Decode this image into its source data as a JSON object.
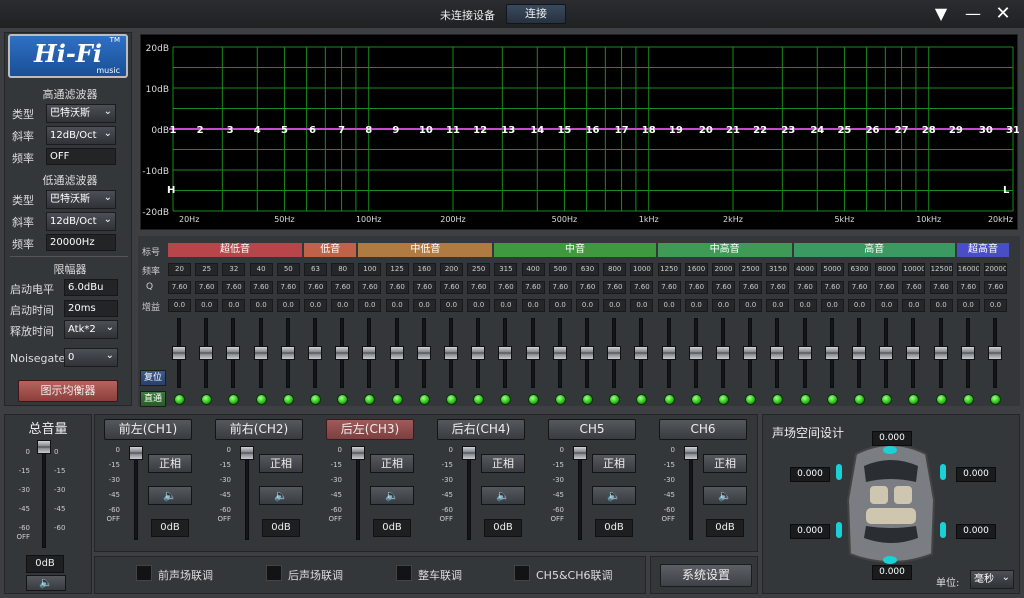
{
  "titlebar": {
    "status": "未连接设备",
    "connect_label": "连接"
  },
  "logo": {
    "text": "Hi-Fi",
    "tm": "TM",
    "sub": "music"
  },
  "highpass": {
    "title": "高通滤波器",
    "type_label": "类型",
    "type_value": "巴特沃斯",
    "slope_label": "斜率",
    "slope_value": "12dB/Oct",
    "freq_label": "频率",
    "freq_value": "OFF"
  },
  "lowpass": {
    "title": "低通滤波器",
    "type_label": "类型",
    "type_value": "巴特沃斯",
    "slope_label": "斜率",
    "slope_value": "12dB/Oct",
    "freq_label": "频率",
    "freq_value": "20000Hz"
  },
  "limiter": {
    "title": "限幅器",
    "level_label": "启动电平",
    "level_value": "6.0dBu",
    "time_label": "启动时间",
    "time_value": "20ms",
    "release_label": "释放时间",
    "release_value": "Atk*2"
  },
  "noisegate": {
    "label": "Noisegate",
    "value": "0"
  },
  "eq_button": "图示均衡器",
  "graph": {
    "y_labels": [
      "20dB",
      "10dB",
      "0dB",
      "-10dB",
      "-20dB"
    ],
    "x_labels": [
      "20Hz",
      "50Hz",
      "100Hz",
      "200Hz",
      "500Hz",
      "1kHz",
      "2kHz",
      "5kHz",
      "10kHz",
      "20kHz"
    ],
    "h_marker": "H",
    "l_marker": "L",
    "curve_color": "#c64ad0",
    "grid_color": "#1d8a1d"
  },
  "eq": {
    "row_labels": {
      "mark": "标号",
      "freq": "频率",
      "q": "Q",
      "gain": "增益"
    },
    "bands": [
      {
        "name": "超低音",
        "color": "#b8454a"
      },
      {
        "name": "低音",
        "color": "#c06248"
      },
      {
        "name": "中低音",
        "color": "#b07b40"
      },
      {
        "name": "中音",
        "color": "#3f9a3f"
      },
      {
        "name": "中高音",
        "color": "#3f9a55"
      },
      {
        "name": "高音",
        "color": "#3a9a62"
      },
      {
        "name": "超高音",
        "color": "#4a4ec6"
      }
    ],
    "freqs": [
      "20",
      "25",
      "32",
      "40",
      "50",
      "63",
      "80",
      "100",
      "125",
      "160",
      "200",
      "250",
      "315",
      "400",
      "500",
      "630",
      "800",
      "1000",
      "1250",
      "1600",
      "2000",
      "2500",
      "3150",
      "4000",
      "5000",
      "6300",
      "8000",
      "10000",
      "12500",
      "16000",
      "20000"
    ],
    "q": [
      "7.60",
      "7.60",
      "7.60",
      "7.60",
      "7.60",
      "7.60",
      "7.60",
      "7.60",
      "7.60",
      "7.60",
      "7.60",
      "7.60",
      "7.60",
      "7.60",
      "7.60",
      "7.60",
      "7.60",
      "7.60",
      "7.60",
      "7.60",
      "7.60",
      "7.60",
      "7.60",
      "7.60",
      "7.60",
      "7.60",
      "7.60",
      "7.60",
      "7.60",
      "7.60",
      "7.60"
    ],
    "gain": [
      "0.0",
      "0.0",
      "0.0",
      "0.0",
      "0.0",
      "0.0",
      "0.0",
      "0.0",
      "0.0",
      "0.0",
      "0.0",
      "0.0",
      "0.0",
      "0.0",
      "0.0",
      "0.0",
      "0.0",
      "0.0",
      "0.0",
      "0.0",
      "0.0",
      "0.0",
      "0.0",
      "0.0",
      "0.0",
      "0.0",
      "0.0",
      "0.0",
      "0.0",
      "0.0",
      "0.0"
    ],
    "reset_label": "复位",
    "bypass_label": "直通"
  },
  "master": {
    "title": "总音量",
    "value": "0dB",
    "scale": [
      "0",
      "-15",
      "-30",
      "-45",
      "-60",
      "OFF"
    ]
  },
  "channels": [
    {
      "name": "前左(CH1)",
      "phase": "正相",
      "db": "0dB"
    },
    {
      "name": "前右(CH2)",
      "phase": "正相",
      "db": "0dB"
    },
    {
      "name": "后左(CH3)",
      "phase": "正相",
      "db": "0dB"
    },
    {
      "name": "后右(CH4)",
      "phase": "正相",
      "db": "0dB"
    },
    {
      "name": "CH5",
      "phase": "正相",
      "db": "0dB"
    },
    {
      "name": "CH6",
      "phase": "正相",
      "db": "0dB"
    }
  ],
  "channel_scale": [
    "0",
    "-15",
    "-30",
    "-45",
    "-60",
    "OFF"
  ],
  "links": [
    "前声场联调",
    "后声场联调",
    "整车联调",
    "CH5&CH6联调"
  ],
  "system_settings": "系统设置",
  "soundfield": {
    "title": "声场空间设计",
    "top": "0.000",
    "left_top": "0.000",
    "right_top": "0.000",
    "left_bottom": "0.000",
    "right_bottom": "0.000",
    "bottom": "0.000",
    "unit_label": "单位:",
    "unit_value": "毫秒"
  }
}
